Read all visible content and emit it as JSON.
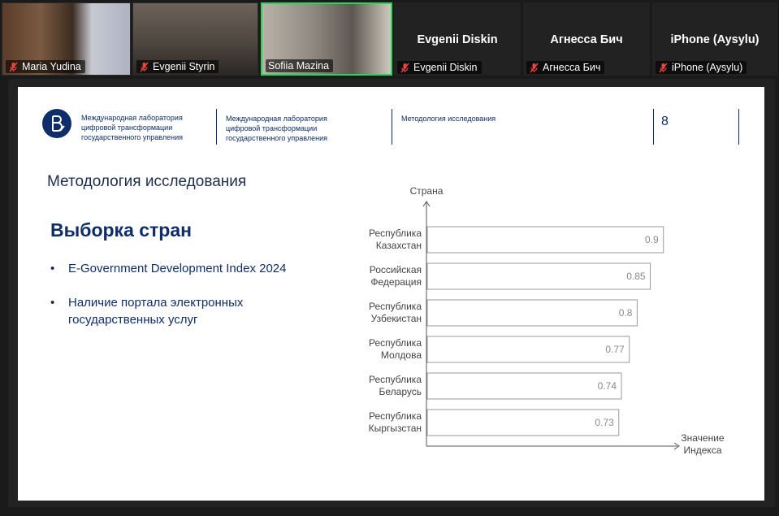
{
  "participants": [
    {
      "name": "Maria Yudina",
      "video": true,
      "active": false
    },
    {
      "name": "Evgenii Styrin",
      "video": true,
      "active": false
    },
    {
      "name": "Sofiia Mazina",
      "video": true,
      "active": true
    },
    {
      "name": "Evgenii Diskin",
      "video": false,
      "active": false
    },
    {
      "name": "Агнесса Бич",
      "video": false,
      "active": false
    },
    {
      "name": "iPhone (Aysylu)",
      "video": false,
      "active": false
    }
  ],
  "slide": {
    "header_org_1": "Международная лаборатория цифровой трансформации государственного управления",
    "header_org_2": "Международная лаборатория цифровой трансформации государственного управления",
    "header_section": "Методология исследования",
    "page_number": "8",
    "title": "Методология исследования",
    "subtitle": "Выборка стран",
    "bullets": [
      "E-Government Development Index 2024",
      "Наличие портала электронных государственных услуг"
    ]
  },
  "chart_data": {
    "type": "bar",
    "orientation": "horizontal",
    "ylabel": "Страна",
    "xlabel": "Значение Индекса",
    "categories": [
      "Республика Казахстан",
      "Российская Федерация",
      "Республика Узбекистан",
      "Республика Молдова",
      "Республика Беларусь",
      "Республика Кыргызстан"
    ],
    "values": [
      0.9,
      0.85,
      0.8,
      0.77,
      0.74,
      0.73
    ],
    "xlim": [
      0,
      1
    ],
    "grid": false,
    "bar_fill": "#ffffff",
    "bar_stroke": "#9a9a9a"
  },
  "colors": {
    "brand_navy": "#0f2d69",
    "active_speaker": "#23d959",
    "mic_muted": "#e8453c"
  }
}
